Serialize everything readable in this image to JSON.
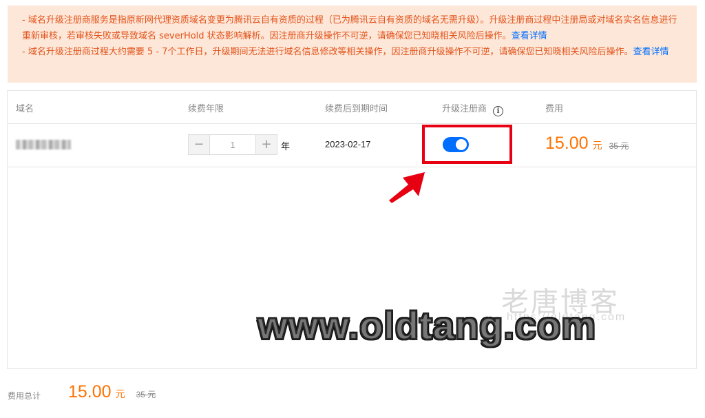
{
  "notice": {
    "line1_text": "- 域名升级注册商服务是指原新网代理资质域名变更为腾讯云自有资质的过程（已为腾讯云自有资质的域名无需升级）。升级注册商过程中注册局或对域名实名信息进行重新审核，若审核失败或导致域名 severHold 状态影响解析。因注册商升级操作不可逆，请确保您已知晓相关风险后操作。",
    "line1_link": "查看详情",
    "line2_text": "- 域名升级注册商过程大约需要 5 - 7个工作日，升级期间无法进行域名信息修改等相关操作，因注册商升级操作不可逆，请确保您已知晓相关风险后操作。",
    "line2_link": "查看详情"
  },
  "table": {
    "headers": {
      "domain": "域名",
      "renew_years": "续费年限",
      "expiry_after": "续费后到期时间",
      "upgrade_registrar": "升级注册商",
      "info_glyph": "i",
      "fee": "费用"
    },
    "row": {
      "stepper_minus": "−",
      "stepper_plus": "+",
      "quantity": "1",
      "year_unit": "年",
      "expiry_date": "2023-02-17",
      "upgrade_enabled": true,
      "price": "15.00",
      "currency": "元",
      "original_price": "35 元"
    }
  },
  "footer": {
    "total_label": "费用总计",
    "total_price": "15.00",
    "currency": "元",
    "original_price": "35 元"
  },
  "watermark": {
    "chinese": "老唐博客",
    "url_small": "https://oldtang.com",
    "url_large": "www.oldtang.com"
  },
  "colors": {
    "notice_bg": "#fde7d8",
    "notice_text": "#e2531b",
    "link": "#006eff",
    "price": "#ff7200",
    "toggle_on": "#006eff",
    "highlight": "#e60012"
  }
}
